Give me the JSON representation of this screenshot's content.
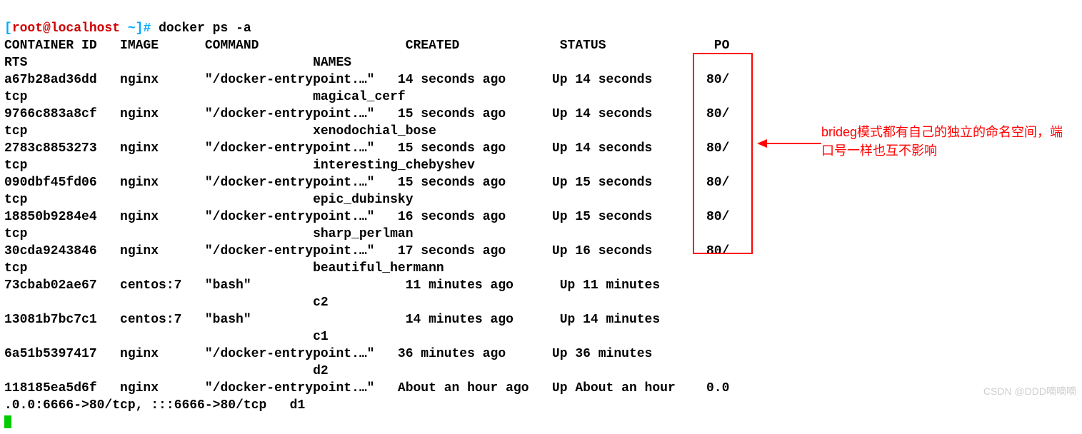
{
  "prompt": {
    "bracket_open": "[",
    "user_host": "root@localhost",
    "path": " ~",
    "bracket_close": "]#",
    "command": " docker ps -a"
  },
  "headers": {
    "line1": "CONTAINER ID   IMAGE      COMMAND                   CREATED             STATUS              PO",
    "line2": "RTS                                     NAMES"
  },
  "rows": [
    {
      "l1": "a67b28ad36dd   nginx      \"/docker-entrypoint.…\"   14 seconds ago      Up 14 seconds       80/",
      "l2": "tcp                                     magical_cerf"
    },
    {
      "l1": "9766c883a8cf   nginx      \"/docker-entrypoint.…\"   15 seconds ago      Up 14 seconds       80/",
      "l2": "tcp                                     xenodochial_bose"
    },
    {
      "l1": "2783c8853273   nginx      \"/docker-entrypoint.…\"   15 seconds ago      Up 14 seconds       80/",
      "l2": "tcp                                     interesting_chebyshev"
    },
    {
      "l1": "090dbf45fd06   nginx      \"/docker-entrypoint.…\"   15 seconds ago      Up 15 seconds       80/",
      "l2": "tcp                                     epic_dubinsky"
    },
    {
      "l1": "18850b9284e4   nginx      \"/docker-entrypoint.…\"   16 seconds ago      Up 15 seconds       80/",
      "l2": "tcp                                     sharp_perlman"
    },
    {
      "l1": "30cda9243846   nginx      \"/docker-entrypoint.…\"   17 seconds ago      Up 16 seconds       80/",
      "l2": "tcp                                     beautiful_hermann"
    },
    {
      "l1": "73cbab02ae67   centos:7   \"bash\"                    11 minutes ago      Up 11 minutes",
      "l2": "                                        c2"
    },
    {
      "l1": "13081b7bc7c1   centos:7   \"bash\"                    14 minutes ago      Up 14 minutes",
      "l2": "                                        c1"
    },
    {
      "l1": "6a51b5397417   nginx      \"/docker-entrypoint.…\"   36 minutes ago      Up 36 minutes",
      "l2": "                                        d2"
    },
    {
      "l1": "118185ea5d6f   nginx      \"/docker-entrypoint.…\"   About an hour ago   Up About an hour    0.0",
      "l2": ".0.0:6666->80/tcp, :::6666->80/tcp   d1"
    }
  ],
  "annotation": "brideg模式都有自己的独立的命名空间，端口号一样也互不影响",
  "watermark": "CSDN @DDD嘀嘀嘀",
  "chart_data": {
    "type": "table",
    "title": "docker ps -a",
    "columns": [
      "CONTAINER ID",
      "IMAGE",
      "COMMAND",
      "CREATED",
      "STATUS",
      "PORTS",
      "NAMES"
    ],
    "rows": [
      [
        "a67b28ad36dd",
        "nginx",
        "/docker-entrypoint.…",
        "14 seconds ago",
        "Up 14 seconds",
        "80/tcp",
        "magical_cerf"
      ],
      [
        "9766c883a8cf",
        "nginx",
        "/docker-entrypoint.…",
        "15 seconds ago",
        "Up 14 seconds",
        "80/tcp",
        "xenodochial_bose"
      ],
      [
        "2783c8853273",
        "nginx",
        "/docker-entrypoint.…",
        "15 seconds ago",
        "Up 14 seconds",
        "80/tcp",
        "interesting_chebyshev"
      ],
      [
        "090dbf45fd06",
        "nginx",
        "/docker-entrypoint.…",
        "15 seconds ago",
        "Up 15 seconds",
        "80/tcp",
        "epic_dubinsky"
      ],
      [
        "18850b9284e4",
        "nginx",
        "/docker-entrypoint.…",
        "16 seconds ago",
        "Up 15 seconds",
        "80/tcp",
        "sharp_perlman"
      ],
      [
        "30cda9243846",
        "nginx",
        "/docker-entrypoint.…",
        "17 seconds ago",
        "Up 16 seconds",
        "80/tcp",
        "beautiful_hermann"
      ],
      [
        "73cbab02ae67",
        "centos:7",
        "bash",
        "11 minutes ago",
        "Up 11 minutes",
        "",
        "c2"
      ],
      [
        "13081b7bc7c1",
        "centos:7",
        "bash",
        "14 minutes ago",
        "Up 14 minutes",
        "",
        "c1"
      ],
      [
        "6a51b5397417",
        "nginx",
        "/docker-entrypoint.…",
        "36 minutes ago",
        "Up 36 minutes",
        "",
        "d2"
      ],
      [
        "118185ea5d6f",
        "nginx",
        "/docker-entrypoint.…",
        "About an hour ago",
        "Up About an hour",
        "0.0.0.0:6666->80/tcp, :::6666->80/tcp",
        "d1"
      ]
    ]
  }
}
